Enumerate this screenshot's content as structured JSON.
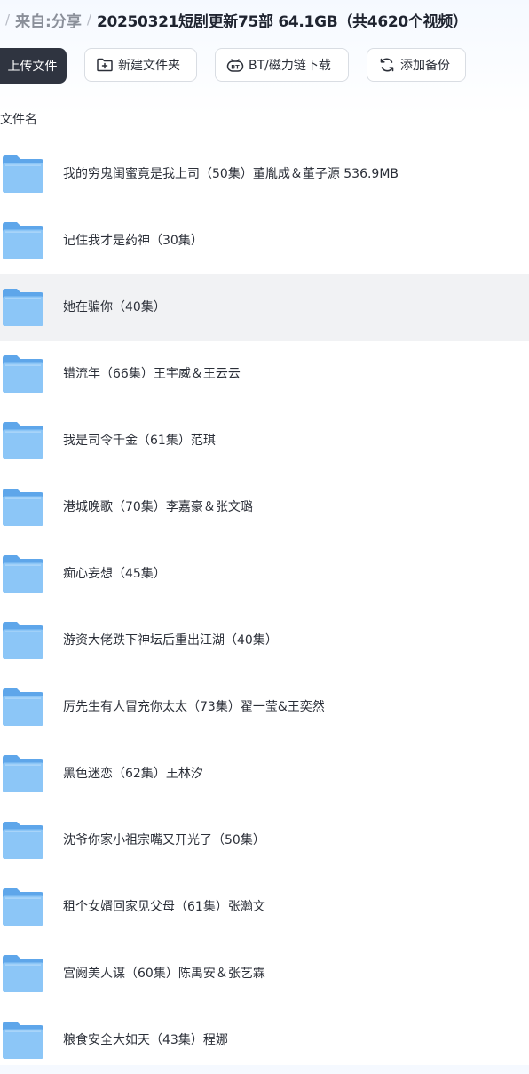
{
  "breadcrumb": {
    "separator": "/",
    "prefix": "来自:",
    "share_link": "分享",
    "current": "20250321短剧更新75部 64.1GB（共4620个视频）"
  },
  "toolbar": {
    "upload_label": "上传文件",
    "new_folder_label": "新建文件夹",
    "bt_label": "BT/磁力链下载",
    "backup_label": "添加备份"
  },
  "table": {
    "header_name": "文件名"
  },
  "files": [
    "我的穷鬼闺蜜竟是我上司（50集）董胤成＆董子源 536.9MB",
    "记住我才是药神（30集）",
    "她在骗你（40集）",
    "错流年（66集）王宇威＆王云云",
    "我是司令千金（61集）范琪",
    "港城晚歌（70集）李嘉豪＆张文璐",
    "痴心妄想（45集）",
    "游资大佬跌下神坛后重出江湖（40集）",
    "厉先生有人冒充你太太（73集）翟一莹&王奕然",
    "黑色迷恋（62集）王林汐",
    "沈爷你家小祖宗嘴又开光了（50集）",
    "租个女婿回家见父母（61集）张瀚文",
    "宫阙美人谋（60集）陈禹安＆张艺霖",
    "粮食安全大如天（43集）程娜"
  ],
  "hovered_row_index": 2,
  "colors": {
    "primary_button": "#2f3440",
    "folder_back": "#5ea6ea",
    "folder_front": "#8cc6f7",
    "hover_row": "#f1f2f4"
  }
}
